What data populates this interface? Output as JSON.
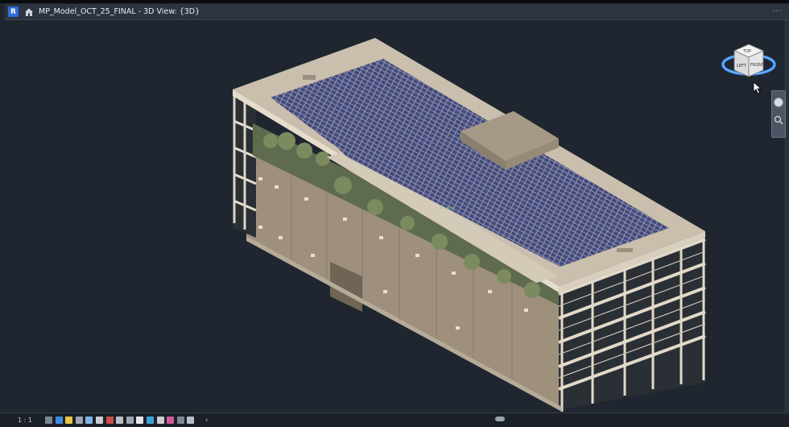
{
  "app": {
    "icon_letter": "R",
    "document_title": "MP_Model_OCT_25_FINAL - 3D View: {3D}"
  },
  "viewcube": {
    "faces": {
      "top": "TOP",
      "front": "FRONT",
      "left": "LEFT"
    }
  },
  "model_label": "PV roof",
  "statusbar": {
    "scale": "1 : 1",
    "scroll_left_arrow": "‹",
    "view_controls": [
      {
        "name": "detail-level-icon",
        "color": "#7a8795"
      },
      {
        "name": "visual-style-icon",
        "color": "#3d8be0"
      },
      {
        "name": "sun-path-icon",
        "color": "#e9c445"
      },
      {
        "name": "shadows-icon",
        "color": "#9aa5b1"
      },
      {
        "name": "render-icon",
        "color": "#7fb2e6"
      },
      {
        "name": "crop-view-icon",
        "color": "#c9ced5"
      },
      {
        "name": "show-crop-icon",
        "color": "#d24b4b"
      },
      {
        "name": "unlock-3d-icon",
        "color": "#b7c0c9"
      },
      {
        "name": "temporary-hide-icon",
        "color": "#9aa5b1"
      },
      {
        "name": "reveal-hidden-icon",
        "color": "#e6e6e6"
      },
      {
        "name": "analysis-icon",
        "color": "#3fa2d6"
      },
      {
        "name": "highlight-displacement-icon",
        "color": "#c9ced5"
      },
      {
        "name": "reveal-constraints-icon",
        "color": "#d25a9a"
      },
      {
        "name": "worksharing-icon",
        "color": "#7a8795"
      },
      {
        "name": "preview-visibility-icon",
        "color": "#b7c0c9"
      }
    ]
  }
}
